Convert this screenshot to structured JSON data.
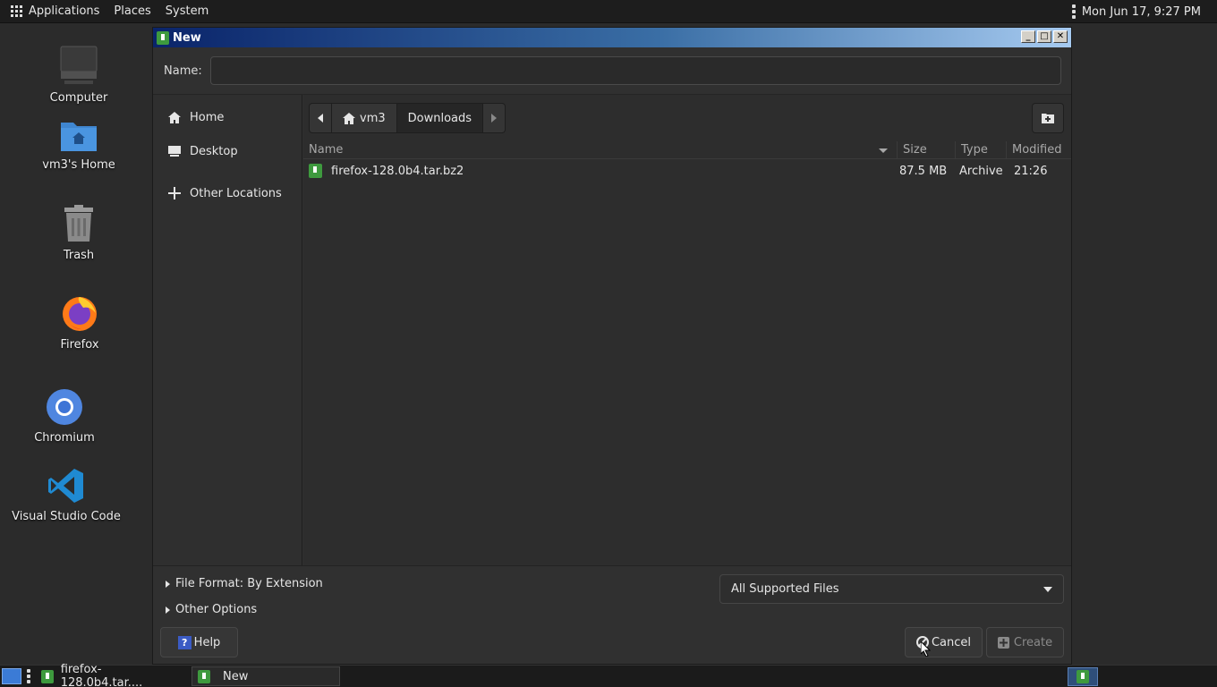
{
  "top_panel": {
    "applications": "Applications",
    "places": "Places",
    "system": "System",
    "clock": "Mon Jun 17,  9:27 PM"
  },
  "desktop": {
    "icons": [
      {
        "label": "Computer",
        "icon": "computer-icon"
      },
      {
        "label": "vm3's Home",
        "icon": "home-folder-icon"
      },
      {
        "label": "Trash",
        "icon": "trash-icon"
      },
      {
        "label": "Firefox",
        "icon": "firefox-icon"
      },
      {
        "label": "Chromium",
        "icon": "chromium-icon"
      },
      {
        "label": "Visual Studio Code",
        "icon": "vscode-icon"
      }
    ]
  },
  "dialog": {
    "title": "New",
    "name_label": "Name:",
    "name_value": "",
    "sidebar": [
      {
        "label": "Home",
        "icon": "home-icon"
      },
      {
        "label": "Desktop",
        "icon": "desktop-icon"
      },
      {
        "label": "Other Locations",
        "icon": "plus-icon"
      }
    ],
    "path": [
      "vm3",
      "Downloads"
    ],
    "columns": {
      "name": "Name",
      "size": "Size",
      "type": "Type",
      "modified": "Modified"
    },
    "files": [
      {
        "name": "firefox-128.0b4.tar.bz2",
        "size": "87.5 MB",
        "type": "Archive",
        "modified": "21:26"
      }
    ],
    "file_format": "File Format: By Extension",
    "other_options": "Other Options",
    "filter": "All Supported Files",
    "help": "Help",
    "cancel": "Cancel",
    "create": "Create"
  },
  "taskbar": {
    "items": [
      "firefox-128.0b4.tar....",
      "New"
    ]
  },
  "colors": {
    "titlebar_start": "#0a246a",
    "titlebar_end": "#a6caf0",
    "app_green": "#3e9a3e"
  }
}
